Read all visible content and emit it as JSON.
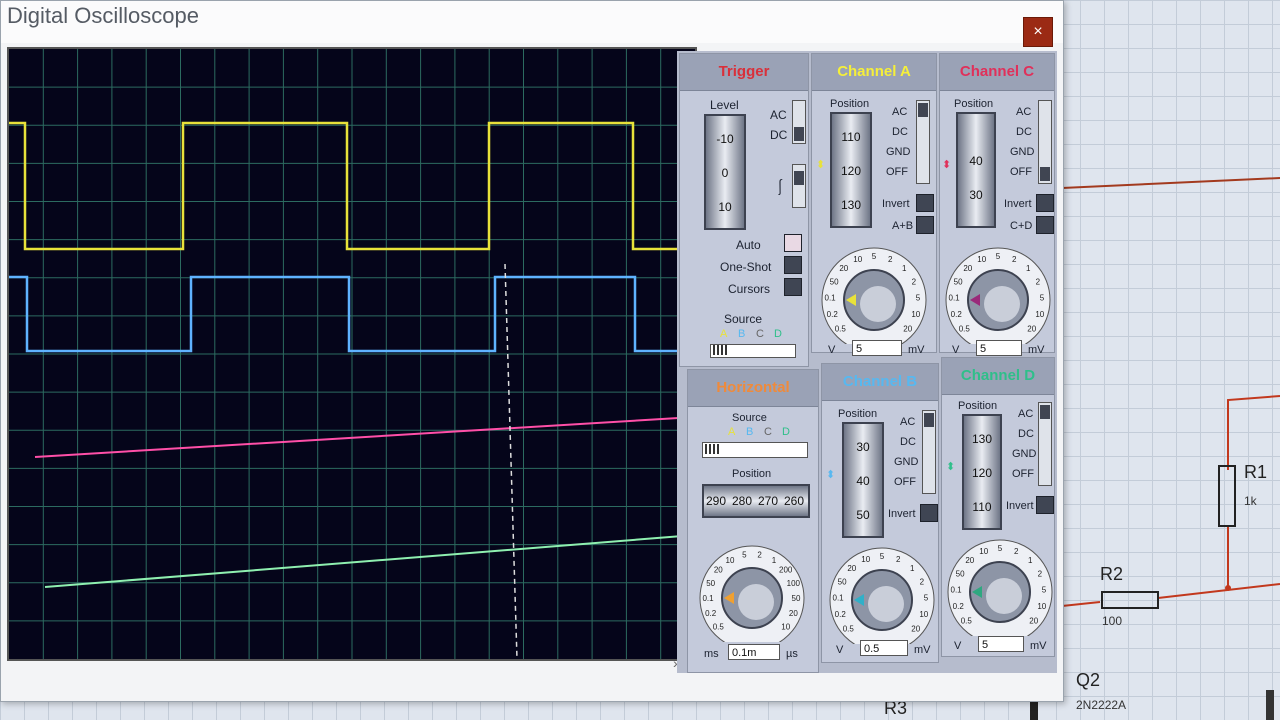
{
  "window": {
    "title": "Digital Oscilloscope",
    "close": "×"
  },
  "trigger": {
    "title": "Trigger",
    "level_label": "Level",
    "level_ticks": [
      "10",
      "0",
      "-10"
    ],
    "ac": "AC",
    "dc": "DC",
    "auto": "Auto",
    "one_shot": "One-Shot",
    "cursors": "Cursors",
    "source_label": "Source",
    "source_options": [
      "A",
      "B",
      "C",
      "D"
    ]
  },
  "channel_a": {
    "title": "Channel A",
    "position_label": "Position",
    "position_ticks": [
      "110",
      "120",
      "130"
    ],
    "coupling": [
      "AC",
      "DC",
      "GND",
      "OFF"
    ],
    "invert": "Invert",
    "combine": "A+B",
    "dial_ticks": [
      "0.5",
      "0.2",
      "0.1",
      "50",
      "20",
      "10",
      "5",
      "2",
      "1",
      "2",
      "5",
      "10",
      "20"
    ],
    "unit_left": "V",
    "unit_right": "mV",
    "value": "5"
  },
  "channel_c": {
    "title": "Channel C",
    "position_label": "Position",
    "position_ticks": [
      "40",
      "30"
    ],
    "coupling": [
      "AC",
      "DC",
      "GND",
      "OFF"
    ],
    "invert": "Invert",
    "combine": "C+D",
    "dial_ticks": [
      "0.5",
      "0.2",
      "0.1",
      "50",
      "20",
      "10",
      "5",
      "2",
      "1",
      "2",
      "5",
      "10",
      "20"
    ],
    "unit_left": "V",
    "unit_right": "mV",
    "value": "5"
  },
  "horizontal": {
    "title": "Horizontal",
    "source_label": "Source",
    "source_options": [
      "A",
      "B",
      "C",
      "D"
    ],
    "position_label": "Position",
    "position_ticks": [
      "290",
      "280",
      "270",
      "260"
    ],
    "dial_ticks": [
      "0.5",
      "0.2",
      "0.1",
      "50",
      "20",
      "10",
      "5",
      "2",
      "1",
      "200",
      "100",
      "50",
      "20",
      "10"
    ],
    "unit_left": "ms",
    "unit_right": "µs",
    "value": "0.1m"
  },
  "channel_b": {
    "title": "Channel B",
    "position_label": "Position",
    "position_ticks": [
      "30",
      "40",
      "50"
    ],
    "coupling": [
      "AC",
      "DC",
      "GND",
      "OFF"
    ],
    "invert": "Invert",
    "dial_ticks": [
      "0.5",
      "0.2",
      "0.1",
      "50",
      "20",
      "10",
      "5",
      "2",
      "1",
      "2",
      "5",
      "10",
      "20"
    ],
    "unit_left": "V",
    "unit_right": "mV",
    "value": "0.5"
  },
  "channel_d": {
    "title": "Channel D",
    "position_label": "Position",
    "position_ticks": [
      "130",
      "120",
      "110"
    ],
    "coupling": [
      "AC",
      "DC",
      "GND",
      "OFF"
    ],
    "invert": "Invert",
    "dial_ticks": [
      "0.5",
      "0.2",
      "0.1",
      "50",
      "20",
      "10",
      "5",
      "2",
      "1",
      "2",
      "5",
      "10",
      "20"
    ],
    "unit_left": "V",
    "unit_right": "mV",
    "value": "5"
  },
  "schematic": {
    "r1": {
      "name": "R1",
      "value": "1k"
    },
    "r2": {
      "name": "R2",
      "value": "100"
    },
    "r3": {
      "name": "R3"
    },
    "q2": {
      "name": "Q2",
      "part": "2N2222A"
    }
  },
  "colors": {
    "trace_a": "#e8e23a",
    "trace_b": "#5fb3ff",
    "trace_c": "#ff4fa8",
    "trace_d": "#8ff0b0",
    "trigger_title": "#d9303a",
    "channel_a_title": "#f5ef3a",
    "channel_b_title": "#57b8f0",
    "channel_c_title": "#e0305a",
    "channel_d_title": "#2fbf8a",
    "horizontal_title": "#f08a3a",
    "grid": "#2c6b60",
    "screen_bg": "#05051a"
  }
}
